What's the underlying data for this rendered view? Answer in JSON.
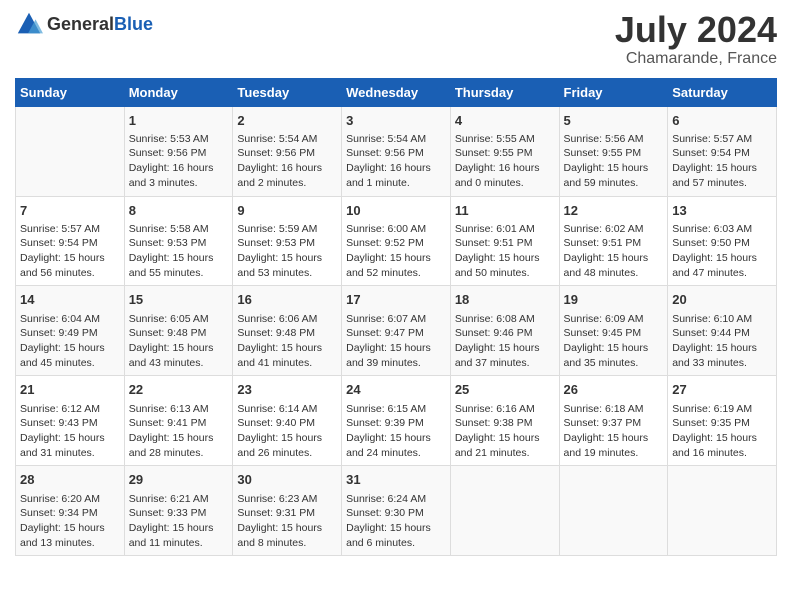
{
  "header": {
    "logo": {
      "general": "General",
      "blue": "Blue"
    },
    "month": "July 2024",
    "location": "Chamarande, France"
  },
  "days_of_week": [
    "Sunday",
    "Monday",
    "Tuesday",
    "Wednesday",
    "Thursday",
    "Friday",
    "Saturday"
  ],
  "weeks": [
    [
      {
        "num": "",
        "info": ""
      },
      {
        "num": "1",
        "info": "Sunrise: 5:53 AM\nSunset: 9:56 PM\nDaylight: 16 hours\nand 3 minutes."
      },
      {
        "num": "2",
        "info": "Sunrise: 5:54 AM\nSunset: 9:56 PM\nDaylight: 16 hours\nand 2 minutes."
      },
      {
        "num": "3",
        "info": "Sunrise: 5:54 AM\nSunset: 9:56 PM\nDaylight: 16 hours\nand 1 minute."
      },
      {
        "num": "4",
        "info": "Sunrise: 5:55 AM\nSunset: 9:55 PM\nDaylight: 16 hours\nand 0 minutes."
      },
      {
        "num": "5",
        "info": "Sunrise: 5:56 AM\nSunset: 9:55 PM\nDaylight: 15 hours\nand 59 minutes."
      },
      {
        "num": "6",
        "info": "Sunrise: 5:57 AM\nSunset: 9:54 PM\nDaylight: 15 hours\nand 57 minutes."
      }
    ],
    [
      {
        "num": "7",
        "info": "Sunrise: 5:57 AM\nSunset: 9:54 PM\nDaylight: 15 hours\nand 56 minutes."
      },
      {
        "num": "8",
        "info": "Sunrise: 5:58 AM\nSunset: 9:53 PM\nDaylight: 15 hours\nand 55 minutes."
      },
      {
        "num": "9",
        "info": "Sunrise: 5:59 AM\nSunset: 9:53 PM\nDaylight: 15 hours\nand 53 minutes."
      },
      {
        "num": "10",
        "info": "Sunrise: 6:00 AM\nSunset: 9:52 PM\nDaylight: 15 hours\nand 52 minutes."
      },
      {
        "num": "11",
        "info": "Sunrise: 6:01 AM\nSunset: 9:51 PM\nDaylight: 15 hours\nand 50 minutes."
      },
      {
        "num": "12",
        "info": "Sunrise: 6:02 AM\nSunset: 9:51 PM\nDaylight: 15 hours\nand 48 minutes."
      },
      {
        "num": "13",
        "info": "Sunrise: 6:03 AM\nSunset: 9:50 PM\nDaylight: 15 hours\nand 47 minutes."
      }
    ],
    [
      {
        "num": "14",
        "info": "Sunrise: 6:04 AM\nSunset: 9:49 PM\nDaylight: 15 hours\nand 45 minutes."
      },
      {
        "num": "15",
        "info": "Sunrise: 6:05 AM\nSunset: 9:48 PM\nDaylight: 15 hours\nand 43 minutes."
      },
      {
        "num": "16",
        "info": "Sunrise: 6:06 AM\nSunset: 9:48 PM\nDaylight: 15 hours\nand 41 minutes."
      },
      {
        "num": "17",
        "info": "Sunrise: 6:07 AM\nSunset: 9:47 PM\nDaylight: 15 hours\nand 39 minutes."
      },
      {
        "num": "18",
        "info": "Sunrise: 6:08 AM\nSunset: 9:46 PM\nDaylight: 15 hours\nand 37 minutes."
      },
      {
        "num": "19",
        "info": "Sunrise: 6:09 AM\nSunset: 9:45 PM\nDaylight: 15 hours\nand 35 minutes."
      },
      {
        "num": "20",
        "info": "Sunrise: 6:10 AM\nSunset: 9:44 PM\nDaylight: 15 hours\nand 33 minutes."
      }
    ],
    [
      {
        "num": "21",
        "info": "Sunrise: 6:12 AM\nSunset: 9:43 PM\nDaylight: 15 hours\nand 31 minutes."
      },
      {
        "num": "22",
        "info": "Sunrise: 6:13 AM\nSunset: 9:41 PM\nDaylight: 15 hours\nand 28 minutes."
      },
      {
        "num": "23",
        "info": "Sunrise: 6:14 AM\nSunset: 9:40 PM\nDaylight: 15 hours\nand 26 minutes."
      },
      {
        "num": "24",
        "info": "Sunrise: 6:15 AM\nSunset: 9:39 PM\nDaylight: 15 hours\nand 24 minutes."
      },
      {
        "num": "25",
        "info": "Sunrise: 6:16 AM\nSunset: 9:38 PM\nDaylight: 15 hours\nand 21 minutes."
      },
      {
        "num": "26",
        "info": "Sunrise: 6:18 AM\nSunset: 9:37 PM\nDaylight: 15 hours\nand 19 minutes."
      },
      {
        "num": "27",
        "info": "Sunrise: 6:19 AM\nSunset: 9:35 PM\nDaylight: 15 hours\nand 16 minutes."
      }
    ],
    [
      {
        "num": "28",
        "info": "Sunrise: 6:20 AM\nSunset: 9:34 PM\nDaylight: 15 hours\nand 13 minutes."
      },
      {
        "num": "29",
        "info": "Sunrise: 6:21 AM\nSunset: 9:33 PM\nDaylight: 15 hours\nand 11 minutes."
      },
      {
        "num": "30",
        "info": "Sunrise: 6:23 AM\nSunset: 9:31 PM\nDaylight: 15 hours\nand 8 minutes."
      },
      {
        "num": "31",
        "info": "Sunrise: 6:24 AM\nSunset: 9:30 PM\nDaylight: 15 hours\nand 6 minutes."
      },
      {
        "num": "",
        "info": ""
      },
      {
        "num": "",
        "info": ""
      },
      {
        "num": "",
        "info": ""
      }
    ]
  ]
}
